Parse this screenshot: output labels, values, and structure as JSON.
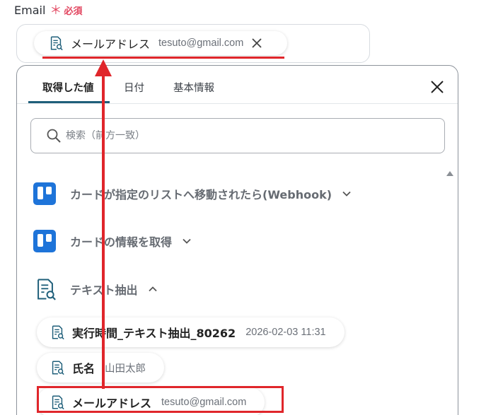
{
  "field": {
    "label": "Email",
    "required_mark": "＊",
    "required_text": "必須"
  },
  "selected_chip": {
    "label": "メールアドレス",
    "value": "tesuto@gmail.com"
  },
  "tabs": [
    {
      "label": "取得した値",
      "active": true
    },
    {
      "label": "日付",
      "active": false
    },
    {
      "label": "基本情報",
      "active": false
    }
  ],
  "search": {
    "placeholder": "検索（前方一致）"
  },
  "sections": [
    {
      "label": "カードが指定のリストへ移動されたら(Webhook)",
      "icon": "trello-icon",
      "expanded": false
    },
    {
      "label": "カードの情報を取得",
      "icon": "trello-icon",
      "expanded": false
    },
    {
      "label": "テキスト抽出",
      "icon": "document-search-icon",
      "expanded": true
    }
  ],
  "items": [
    {
      "label": "実行時間_テキスト抽出_80262",
      "value": "2026-02-03 11:31"
    },
    {
      "label": "氏名",
      "value": "山田太郎"
    },
    {
      "label": "メールアドレス",
      "value": "tesuto@gmail.com"
    }
  ],
  "colors": {
    "accent": "#1f5f7a",
    "annotation_red": "#e0262b",
    "required": "#e2455f",
    "trello_blue": "#1e74d9"
  }
}
